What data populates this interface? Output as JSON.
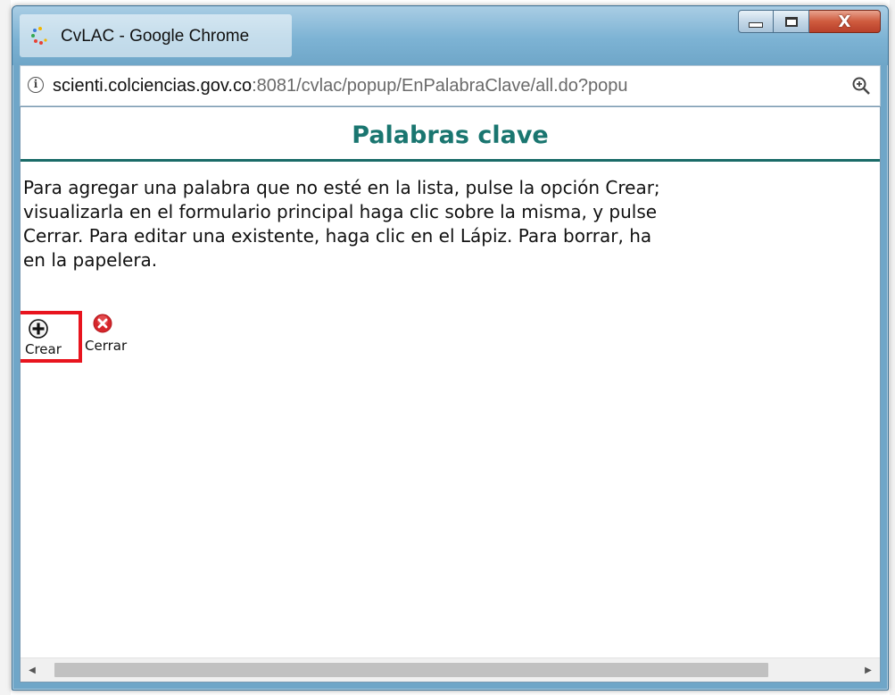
{
  "window": {
    "title": "CvLAC - Google Chrome",
    "controls": {
      "minimize": "minimize-icon",
      "maximize": "maximize-icon",
      "close": "X"
    }
  },
  "address": {
    "host": "scienti.colciencias.gov.co",
    "path": ":8081/cvlac/popup/EnPalabraClave/all.do?popu",
    "info_icon": "i"
  },
  "page": {
    "heading": "Palabras clave",
    "instructions": [
      "Para agregar una palabra que no esté en la lista, pulse la opción Crear;",
      "visualizarla en el formulario principal haga clic sobre la misma, y pulse",
      "Cerrar. Para editar una existente, haga clic en el Lápiz. Para borrar, ha",
      "en la papelera."
    ],
    "actions": {
      "crear": {
        "label": "Crear",
        "icon": "plus-circle-icon"
      },
      "cerrar": {
        "label": "Cerrar",
        "icon": "red-x-circle-icon"
      }
    }
  },
  "colors": {
    "heading": "#1a7670",
    "highlight": "#e8141e",
    "frame": "#6fa6c8"
  }
}
